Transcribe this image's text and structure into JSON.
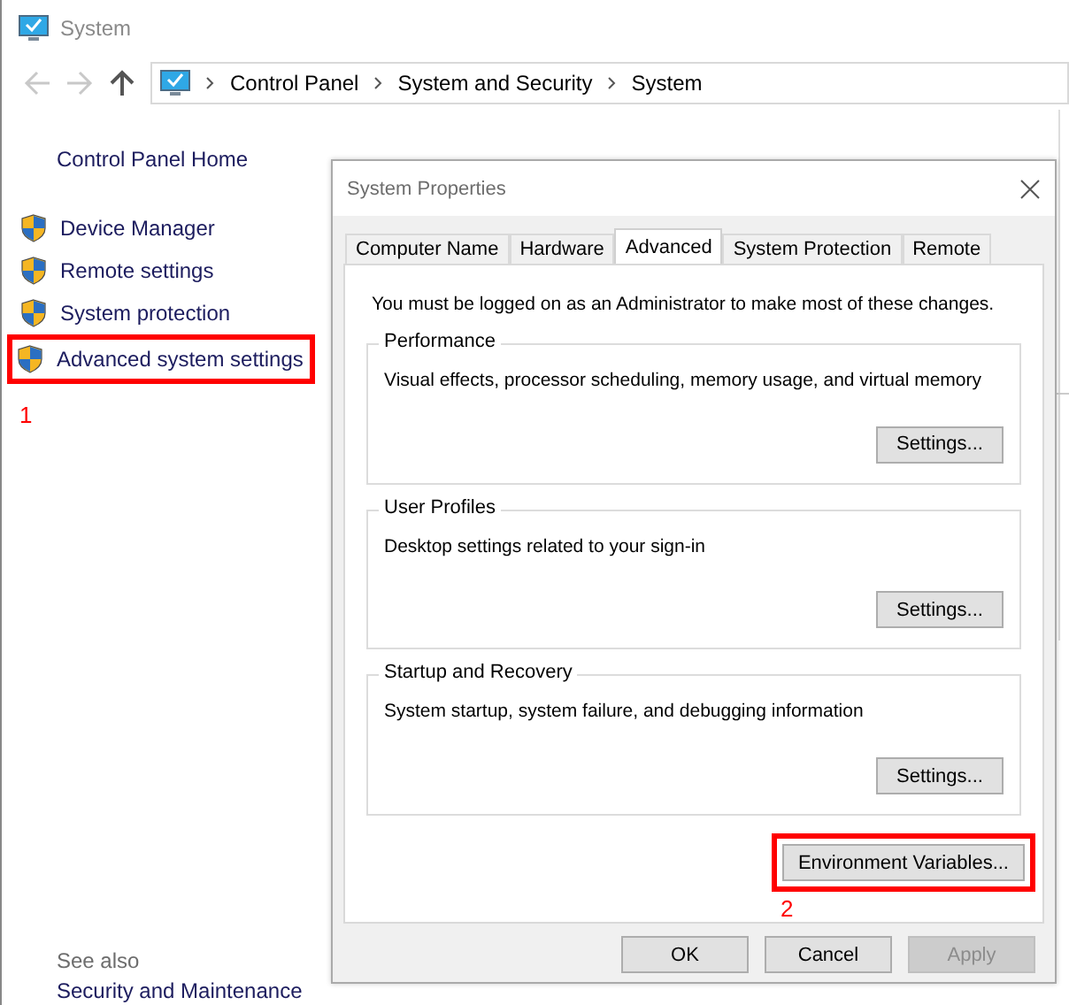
{
  "window": {
    "title": "System"
  },
  "breadcrumb": [
    "Control Panel",
    "System and Security",
    "System"
  ],
  "sidebar": {
    "home": "Control Panel Home",
    "items": [
      {
        "label": "Device Manager",
        "highlighted": false
      },
      {
        "label": "Remote settings",
        "highlighted": false
      },
      {
        "label": "System protection",
        "highlighted": false
      },
      {
        "label": "Advanced system settings",
        "highlighted": true,
        "step": "1"
      }
    ],
    "see_also": {
      "heading": "See also",
      "links": [
        "Security and Maintenance"
      ]
    }
  },
  "dialog": {
    "title": "System Properties",
    "tabs": [
      {
        "label": "Computer Name",
        "selected": false
      },
      {
        "label": "Hardware",
        "selected": false
      },
      {
        "label": "Advanced",
        "selected": true
      },
      {
        "label": "System Protection",
        "selected": false
      },
      {
        "label": "Remote",
        "selected": false
      }
    ],
    "notice": "You must be logged on as an Administrator to make most of these changes.",
    "groups": [
      {
        "title": "Performance",
        "description": "Visual effects, processor scheduling, memory usage, and virtual memory",
        "button": "Settings..."
      },
      {
        "title": "User Profiles",
        "description": "Desktop settings related to your sign-in",
        "button": "Settings..."
      },
      {
        "title": "Startup and Recovery",
        "description": "System startup, system failure, and debugging information",
        "button": "Settings..."
      }
    ],
    "extra_button": {
      "label": "Environment Variables...",
      "highlighted": true,
      "step": "2"
    },
    "buttons": [
      {
        "label": "OK",
        "disabled": false
      },
      {
        "label": "Cancel",
        "disabled": false
      },
      {
        "label": "Apply",
        "disabled": true
      }
    ]
  }
}
